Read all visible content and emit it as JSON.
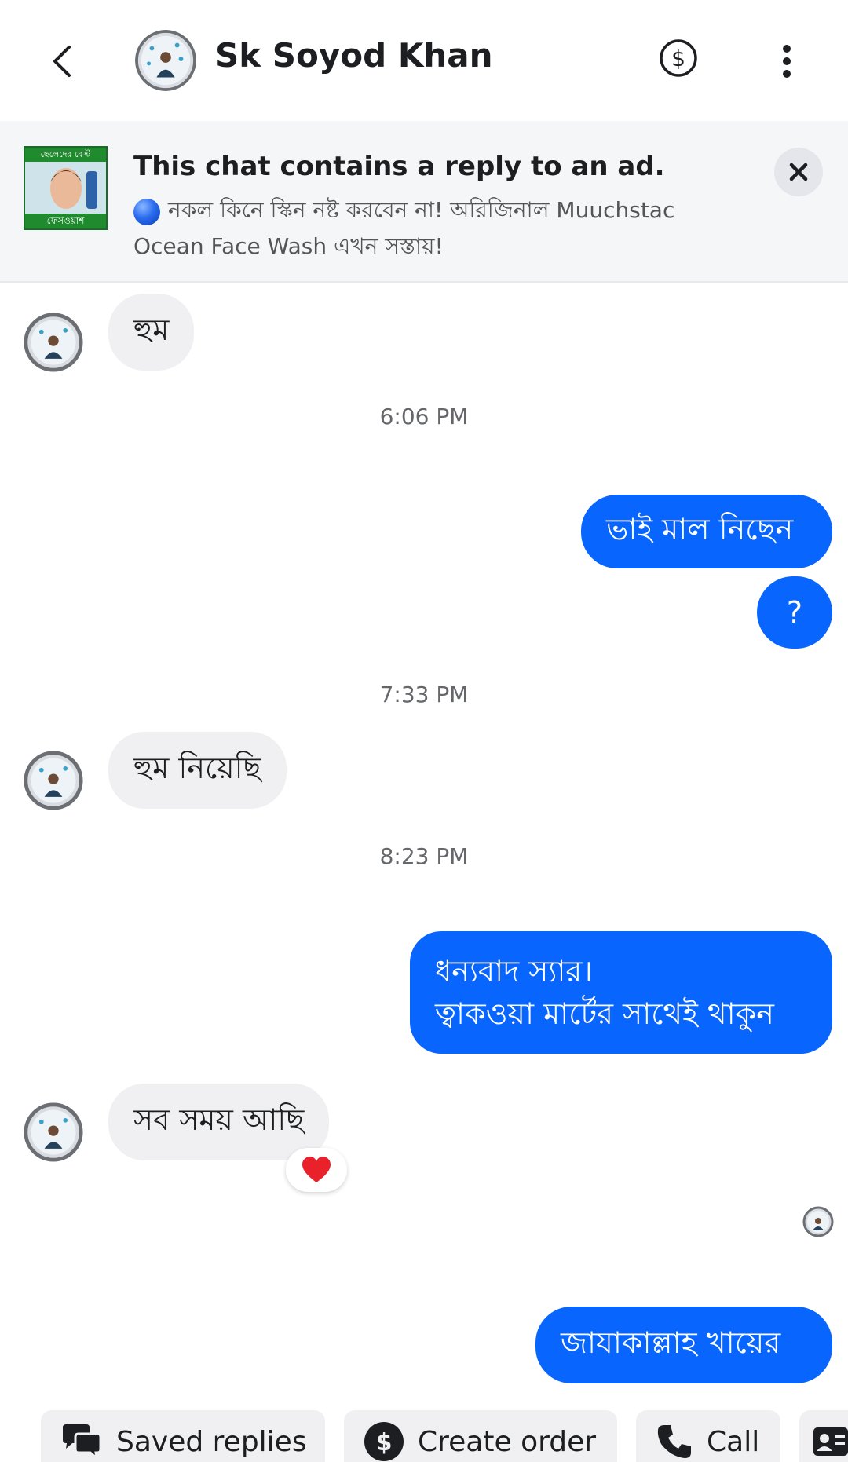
{
  "header": {
    "contact_name": "Sk Soyod Khan"
  },
  "ad_banner": {
    "title": "This chat contains a reply to an ad.",
    "text_line1": "নকল কিনে স্কিন নষ্ট করবেন না! অরিজিনাল Muuchstac",
    "text_line2": "Ocean Face Wash এখন সস্তায়!",
    "thumb_top_text": "ছেলেদের বেস্ট",
    "thumb_bottom_text": "ফেসওয়াশ"
  },
  "messages": {
    "m1": "হুম",
    "t1": "6:06 PM",
    "m2": "ভাই মাল নিছেন",
    "m3": "?",
    "t2": "7:33 PM",
    "m4": "হুম নিয়েছি",
    "t3": "8:23 PM",
    "m5_line1": "ধন্যবাদ স্যার।",
    "m5_line2": "ত্বাকওয়া মার্টের সাথেই থাকুন",
    "m6": "সব সময় আছি",
    "m6_reaction": "heart",
    "m7": "জাযাকাল্লাহ খায়ের"
  },
  "quick_actions": {
    "saved_replies": "Saved replies",
    "create_order": "Create order",
    "call": "Call"
  },
  "icons": {
    "back": "chevron-left-icon",
    "dollar": "dollar-circle-icon",
    "more": "more-vertical-icon",
    "close": "close-icon",
    "saved_replies": "chat-bubbles-icon",
    "create_order": "dollar-circle-icon",
    "call": "phone-icon",
    "contact": "contact-card-icon"
  },
  "colors": {
    "outgoing_bubble": "#0866ff",
    "incoming_bubble": "#f0f0f2",
    "banner_bg": "#f5f6f7",
    "reaction": "#e8212b"
  }
}
